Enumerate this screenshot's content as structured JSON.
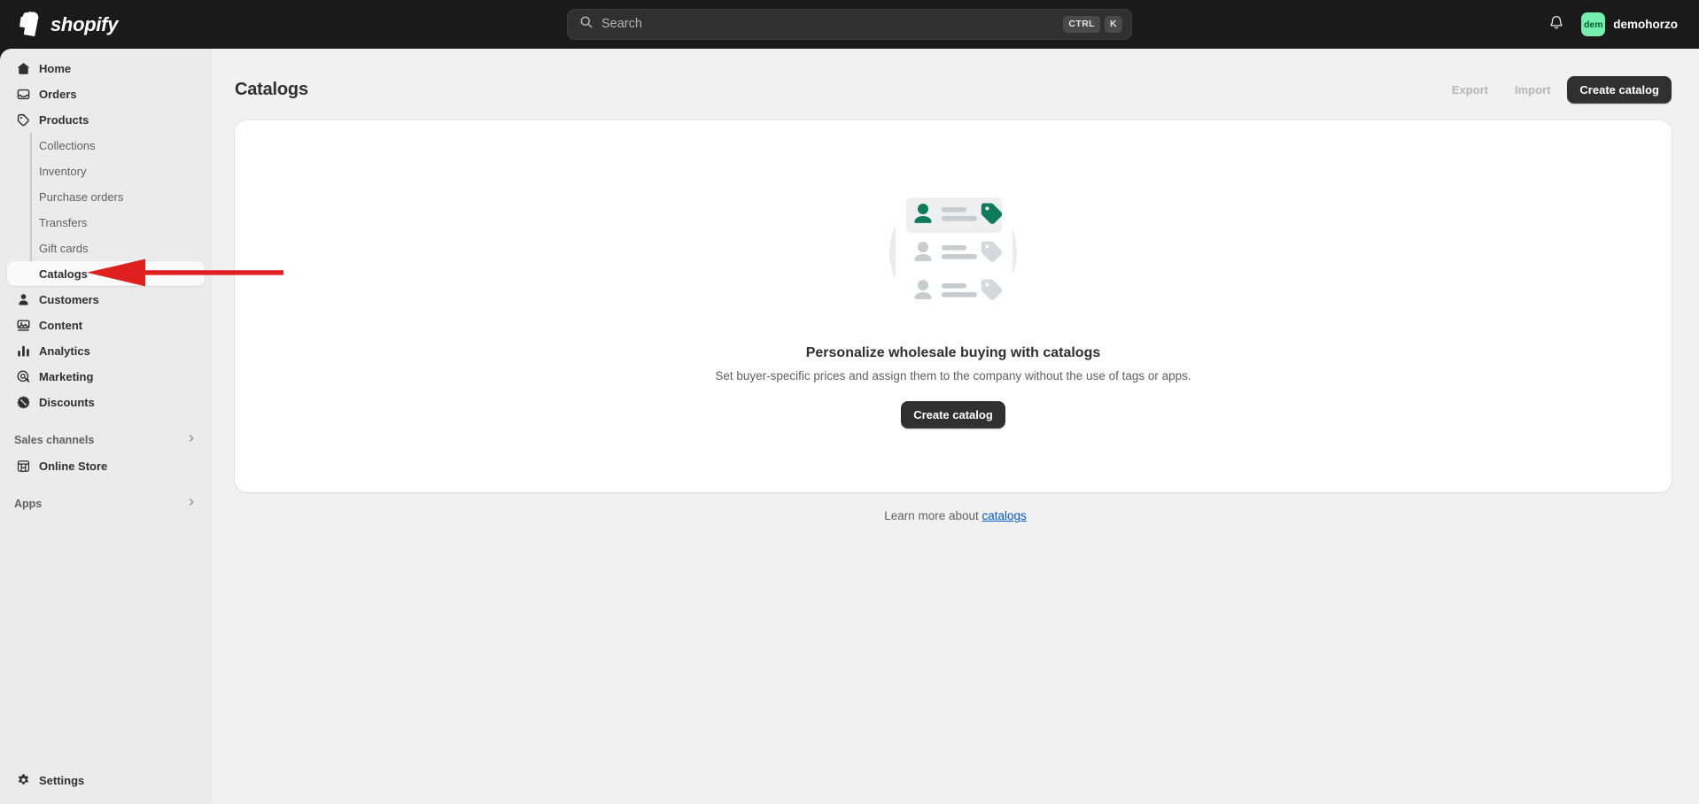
{
  "topbar": {
    "brand_name": "shopify",
    "brand_logo_icon": "shopify-bag-icon",
    "search": {
      "placeholder": "Search",
      "icon": "search-icon",
      "shortcut_modifier": "CTRL",
      "shortcut_key": "K"
    },
    "notifications_icon": "bell-icon",
    "user": {
      "avatar_initials": "dem",
      "name": "demohorzo",
      "avatar_color": "#75f0ac"
    }
  },
  "sidebar": {
    "items": [
      {
        "label": "Home",
        "icon": "home-icon"
      },
      {
        "label": "Orders",
        "icon": "orders-inbox-icon"
      },
      {
        "label": "Products",
        "icon": "products-tag-icon"
      }
    ],
    "product_subitems": [
      {
        "label": "Collections",
        "selected": false
      },
      {
        "label": "Inventory",
        "selected": false
      },
      {
        "label": "Purchase orders",
        "selected": false
      },
      {
        "label": "Transfers",
        "selected": false
      },
      {
        "label": "Gift cards",
        "selected": false
      },
      {
        "label": "Catalogs",
        "selected": true
      }
    ],
    "items_after": [
      {
        "label": "Customers",
        "icon": "customer-person-icon"
      },
      {
        "label": "Content",
        "icon": "content-media-icon"
      },
      {
        "label": "Analytics",
        "icon": "analytics-bar-chart-icon"
      },
      {
        "label": "Marketing",
        "icon": "marketing-target-icon"
      },
      {
        "label": "Discounts",
        "icon": "discount-badge-icon"
      }
    ],
    "sections": [
      {
        "title": "Sales channels",
        "chevron_icon": "chevron-right-icon",
        "children": [
          {
            "label": "Online Store",
            "icon": "storefront-icon"
          }
        ]
      },
      {
        "title": "Apps",
        "chevron_icon": "chevron-right-icon",
        "children": []
      }
    ],
    "settings": {
      "label": "Settings",
      "icon": "gear-icon"
    }
  },
  "page": {
    "title": "Catalogs",
    "actions": {
      "export_label": "Export",
      "import_label": "Import",
      "create_label": "Create catalog"
    },
    "empty_state": {
      "illustration_icon": "catalog-list-illustration",
      "title": "Personalize wholesale buying with catalogs",
      "subtitle": "Set buyer-specific prices and assign them to the company without the use of tags or apps.",
      "cta_label": "Create catalog",
      "accent_color": "#0e7b5c"
    },
    "footer": {
      "prefix": "Learn more about ",
      "link_label": "catalogs",
      "link_color": "#005bd3"
    }
  },
  "annotation": {
    "arrow_color": "#e01f1f",
    "points_to": "Catalogs"
  }
}
